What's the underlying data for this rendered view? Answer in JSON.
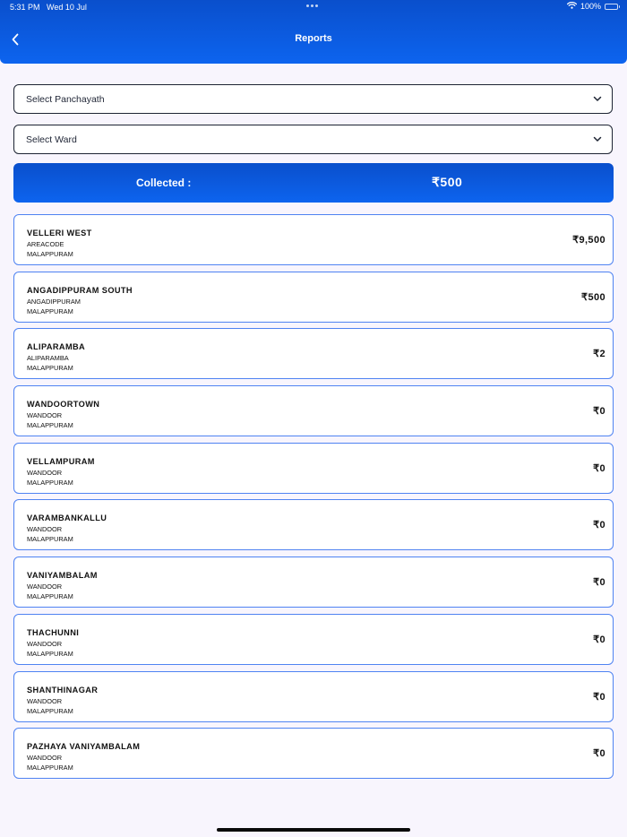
{
  "status_bar": {
    "time_date": "5:31 PM   Wed 10 Jul",
    "battery": "100%",
    "battery_level": 1.0
  },
  "header": {
    "title": "Reports",
    "back_icon": "chevron-left-icon"
  },
  "filters": {
    "panchayath": "Select Panchayath",
    "ward": "Select Ward"
  },
  "summary": {
    "label": "Collected :",
    "amount": "₹500"
  },
  "reports": [
    {
      "name": "VELLERI WEST",
      "area": "AREACODE",
      "district": "MALAPPURAM",
      "amount": "₹9,500"
    },
    {
      "name": "ANGADIPPURAM SOUTH",
      "area": "ANGADIPPURAM",
      "district": "MALAPPURAM",
      "amount": "₹500"
    },
    {
      "name": "ALIPARAMBA",
      "area": "ALIPARAMBA",
      "district": "MALAPPURAM",
      "amount": "₹2"
    },
    {
      "name": "WANDOORTOWN",
      "area": "WANDOOR",
      "district": "MALAPPURAM",
      "amount": "₹0"
    },
    {
      "name": "VELLAMPURAM",
      "area": "WANDOOR",
      "district": "MALAPPURAM",
      "amount": "₹0"
    },
    {
      "name": "VARAMBANKALLU",
      "area": "WANDOOR",
      "district": "MALAPPURAM",
      "amount": "₹0"
    },
    {
      "name": "VANIYAMBALAM",
      "area": "WANDOOR",
      "district": "MALAPPURAM",
      "amount": "₹0"
    },
    {
      "name": "THACHUNNI",
      "area": "WANDOOR",
      "district": "MALAPPURAM",
      "amount": "₹0"
    },
    {
      "name": "SHANTHINAGAR",
      "area": "WANDOOR",
      "district": "MALAPPURAM",
      "amount": "₹0"
    },
    {
      "name": "PAZHAYA VANIYAMBALAM",
      "area": "WANDOOR",
      "district": "MALAPPURAM",
      "amount": "₹0"
    }
  ],
  "colors": {
    "accent": "#0d5fe8",
    "card_border": "#4f83f2",
    "background": "#f8f5fd"
  }
}
